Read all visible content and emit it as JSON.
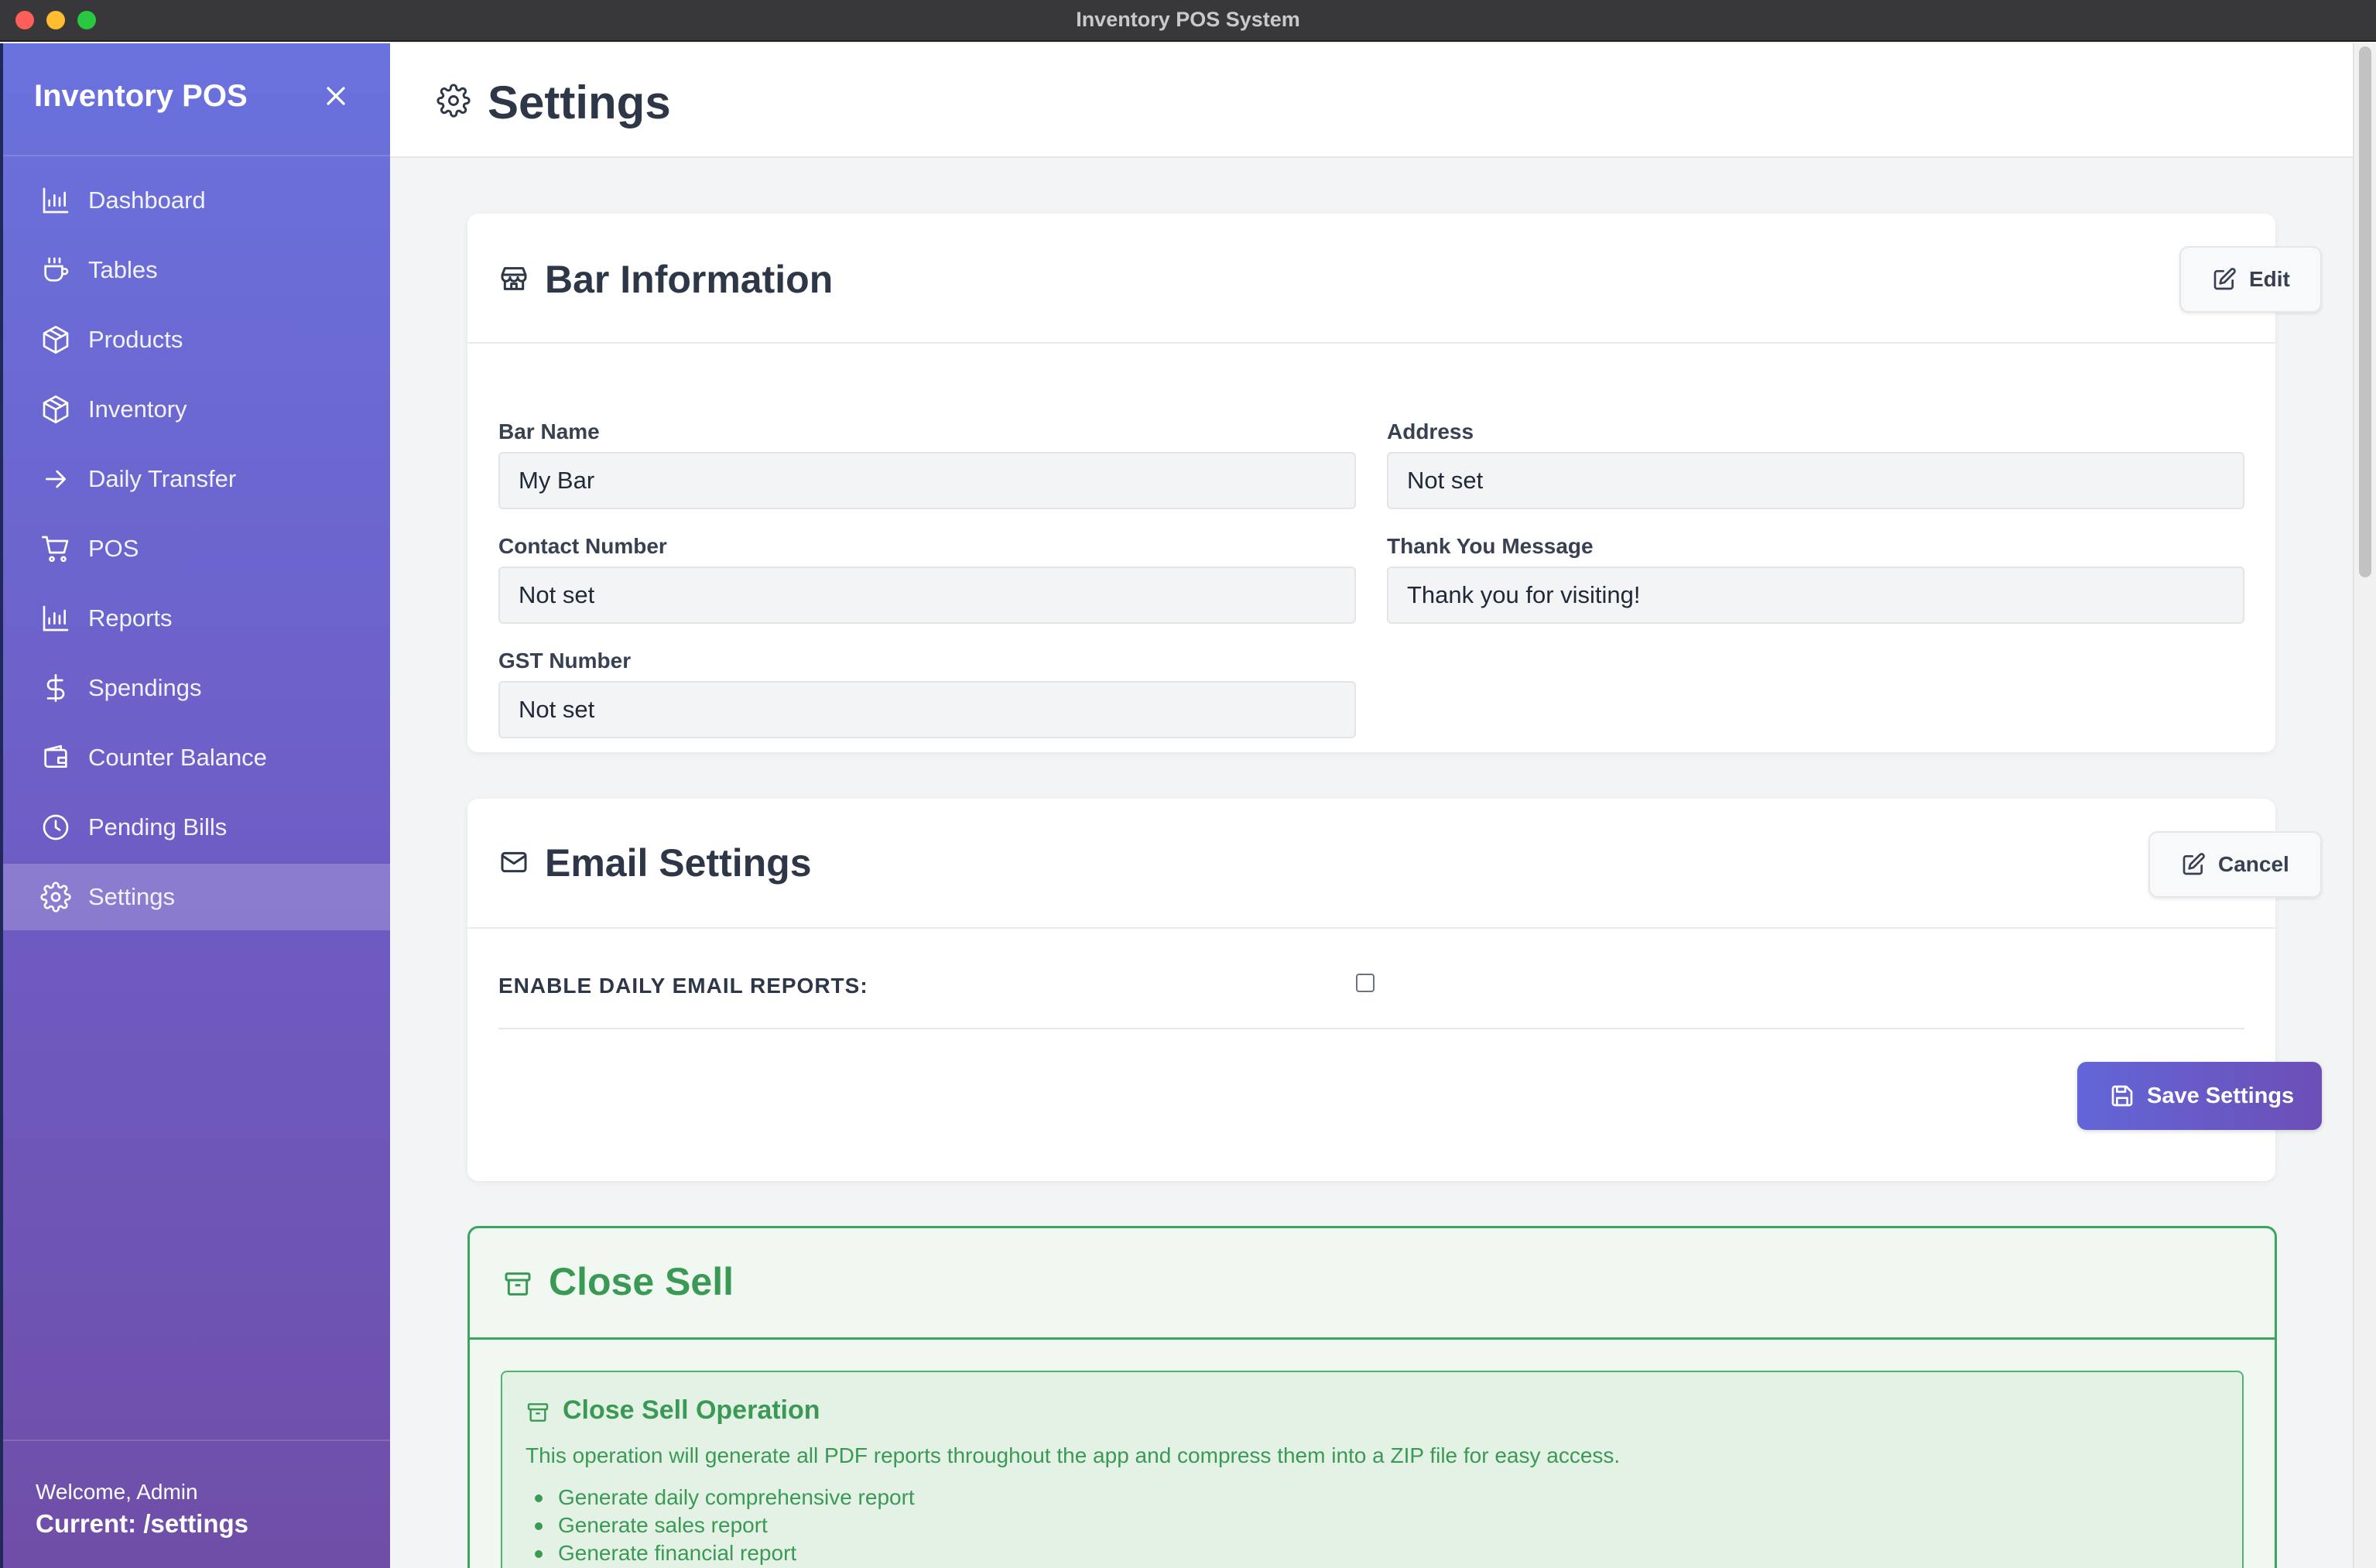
{
  "window": {
    "title": "Inventory POS System"
  },
  "sidebar": {
    "app_name": "Inventory POS",
    "items": [
      {
        "label": "Dashboard",
        "icon": "bar-chart-icon"
      },
      {
        "label": "Tables",
        "icon": "coffee-cup-icon"
      },
      {
        "label": "Products",
        "icon": "package-icon"
      },
      {
        "label": "Inventory",
        "icon": "package-icon"
      },
      {
        "label": "Daily Transfer",
        "icon": "arrow-right-icon"
      },
      {
        "label": "POS",
        "icon": "shopping-cart-icon"
      },
      {
        "label": "Reports",
        "icon": "bar-chart-icon"
      },
      {
        "label": "Spendings",
        "icon": "dollar-icon"
      },
      {
        "label": "Counter Balance",
        "icon": "wallet-icon"
      },
      {
        "label": "Pending Bills",
        "icon": "clock-icon"
      },
      {
        "label": "Settings",
        "icon": "gear-icon",
        "active": true
      }
    ],
    "footer": {
      "welcome": "Welcome, Admin",
      "current": "Current: /settings"
    }
  },
  "page": {
    "title": "Settings"
  },
  "bar_info": {
    "title": "Bar Information",
    "edit_label": "Edit",
    "fields": {
      "bar_name": {
        "label": "Bar Name",
        "value": "My Bar"
      },
      "address": {
        "label": "Address",
        "value": "Not set"
      },
      "contact": {
        "label": "Contact Number",
        "value": "Not set"
      },
      "thanks": {
        "label": "Thank You Message",
        "value": "Thank you for visiting!"
      },
      "gst": {
        "label": "GST Number",
        "value": "Not set"
      }
    }
  },
  "email": {
    "title": "Email Settings",
    "cancel_label": "Cancel",
    "enable_label": "ENABLE DAILY EMAIL REPORTS:",
    "enabled": false,
    "save_label": "Save Settings"
  },
  "close_sell": {
    "title": "Close Sell",
    "op_title": "Close Sell Operation",
    "description": "This operation will generate all PDF reports throughout the app and compress them into a ZIP file for easy access.",
    "items": [
      "Generate daily comprehensive report",
      "Generate sales report",
      "Generate financial report"
    ]
  },
  "colors": {
    "sidebar_top": "#6a72dd",
    "sidebar_bottom": "#6f4ea7",
    "accent_green": "#3a9a55",
    "primary": "#6366d8"
  }
}
